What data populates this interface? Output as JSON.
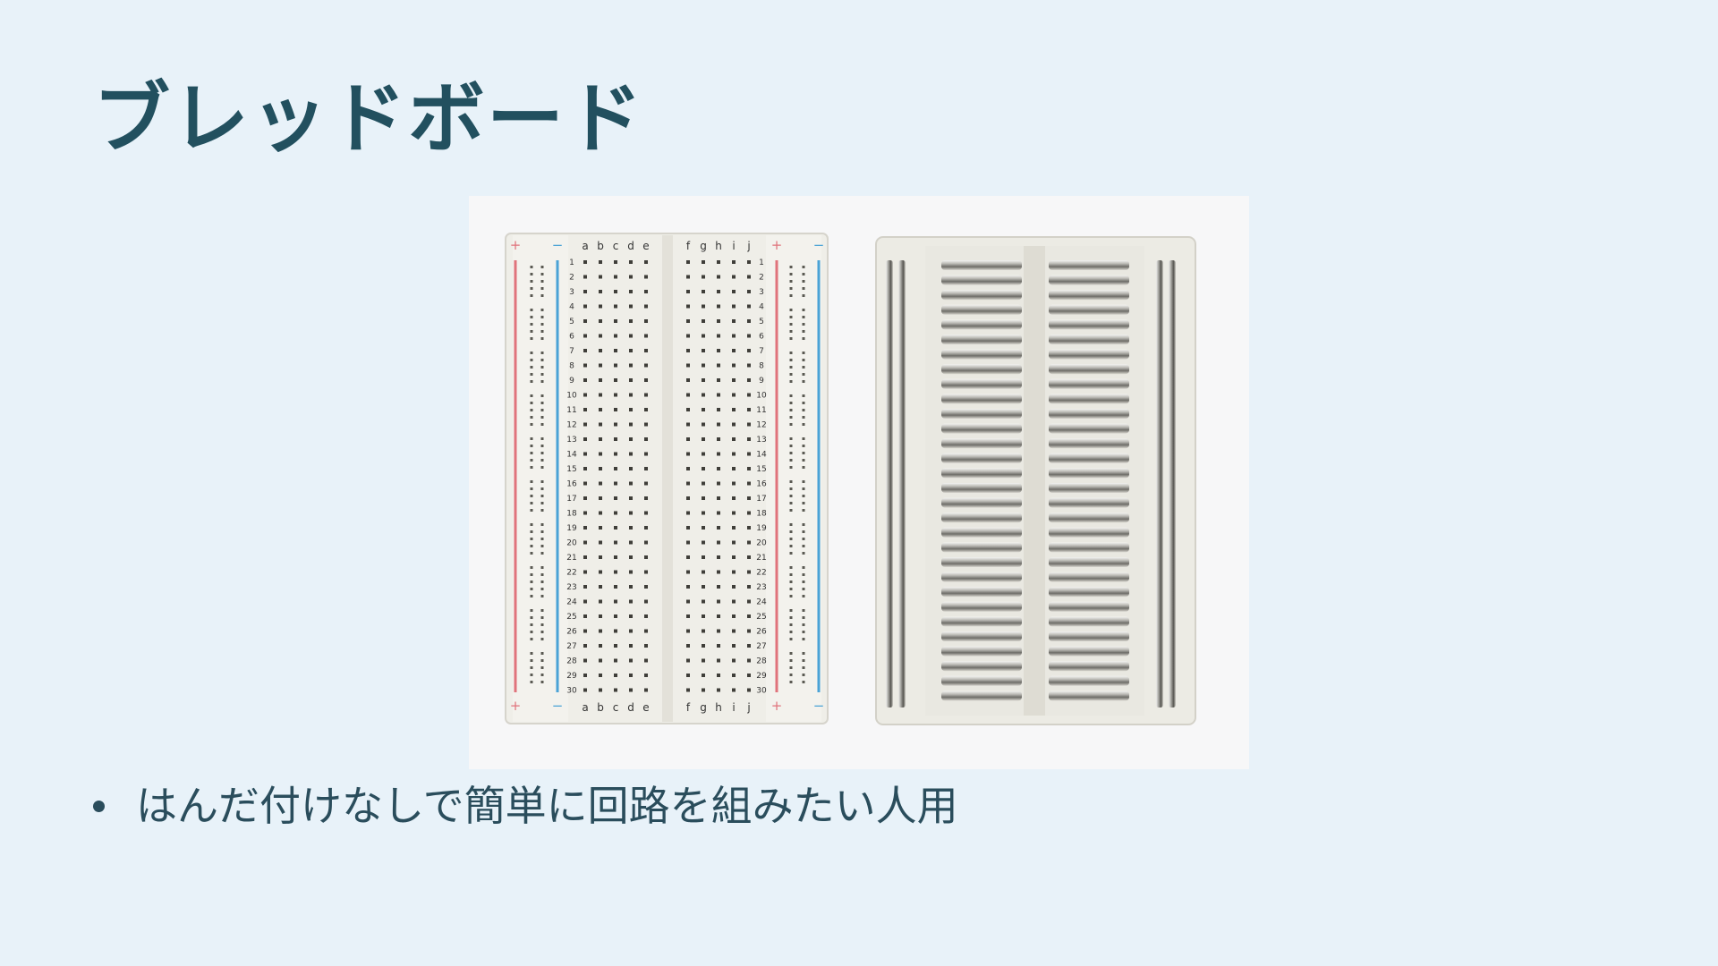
{
  "slide": {
    "title": "ブレッドボード",
    "bullets": [
      "はんだ付けなしで簡単に回路を組みたい人用"
    ]
  },
  "photo": {
    "front_board": {
      "left_columns": [
        "a",
        "b",
        "c",
        "d",
        "e"
      ],
      "right_columns": [
        "f",
        "g",
        "h",
        "i",
        "j"
      ],
      "row_count": 30,
      "plus_sign": "+",
      "minus_sign": "−",
      "plus_rail_color": "#e0737b",
      "minus_rail_color": "#4aa3d6",
      "board_color": "#eeede6"
    },
    "back_board": {
      "strip_color": "#c9c8c4"
    }
  }
}
